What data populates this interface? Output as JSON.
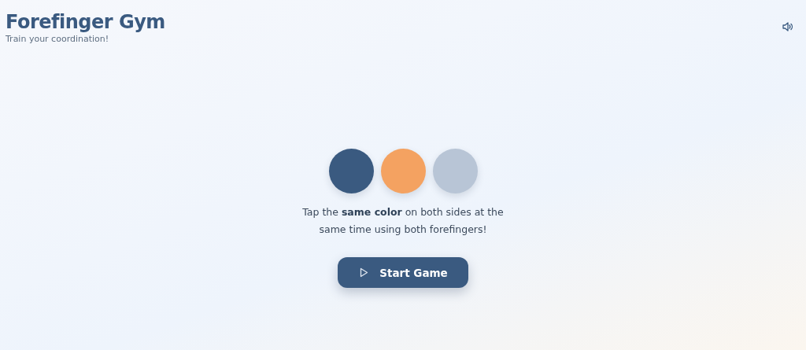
{
  "header": {
    "title": "Forefinger Gym",
    "subtitle": "Train your coordination!"
  },
  "circles": [
    {
      "color": "#3a5a80"
    },
    {
      "color": "#f4a261"
    },
    {
      "color": "#b8c5d6"
    }
  ],
  "instructions": "Tap the **same color** on both sides at the same time using both forefingers!",
  "start_button": {
    "label": "Start Game"
  }
}
